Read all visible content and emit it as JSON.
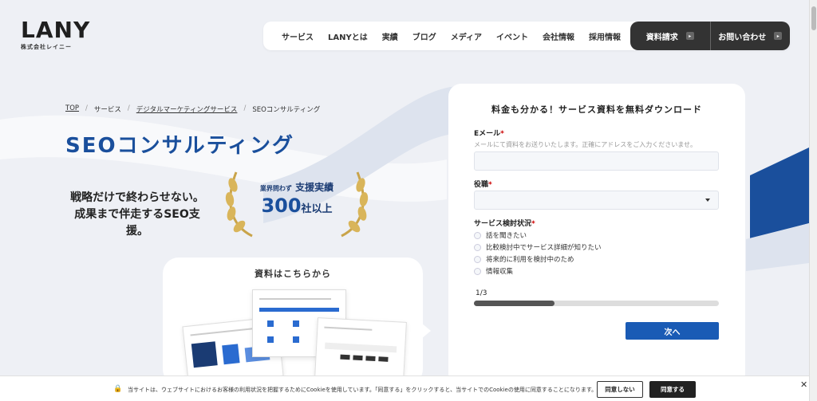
{
  "header": {
    "logo": "LANY",
    "logo_sub": "株式会社レイニー",
    "nav": [
      "サービス",
      "LANYとは",
      "実績",
      "ブログ",
      "メディア",
      "イベント",
      "会社情報",
      "採用情報"
    ],
    "cta_docs": "資料請求",
    "cta_contact": "お問い合わせ"
  },
  "breadcrumb": {
    "top": "TOP",
    "service": "サービス",
    "digital": "デジタルマーケティングサービス",
    "current": "SEOコンサルティング"
  },
  "hero": {
    "title": "SEOコンサルティング",
    "tagline1": "戦略だけで終わらせない。",
    "tagline2": "成果まで伴走するSEO支援。",
    "badge_small": "業界問わず",
    "badge_label": "支援実績",
    "badge_number": "300",
    "badge_unit": "社以上"
  },
  "doc_card": {
    "title": "資料はこちらから"
  },
  "form": {
    "heading": "料金も分かる！サービス資料を無料ダウンロード",
    "email_label": "Eメール",
    "email_hint": "メールにて資料をお送りいたします。正確にアドレスをご入力くださいませ。",
    "role_label": "役職",
    "status_label": "サービス検討状況",
    "required_mark": "*",
    "options": [
      "話を聞きたい",
      "比較検討中でサービス詳細が知りたい",
      "将来的に利用を検討中のため",
      "情報収集"
    ],
    "progress_text": "1/3",
    "progress": 0.33,
    "next_label": "次へ"
  },
  "cookie": {
    "text": "当サイトは、ウェブサイトにおけるお客様の利用状況を把握するためにCookieを使用しています。「同意する」をクリックすると、当サイトでのCookieの使用に同意することになります。",
    "decline": "同意しない",
    "accept": "同意する",
    "close": "✕"
  },
  "colors": {
    "brand_blue": "#1a4f9c",
    "button_blue": "#1a5bb5",
    "dark": "#333333",
    "gold": "#c9a44a"
  }
}
